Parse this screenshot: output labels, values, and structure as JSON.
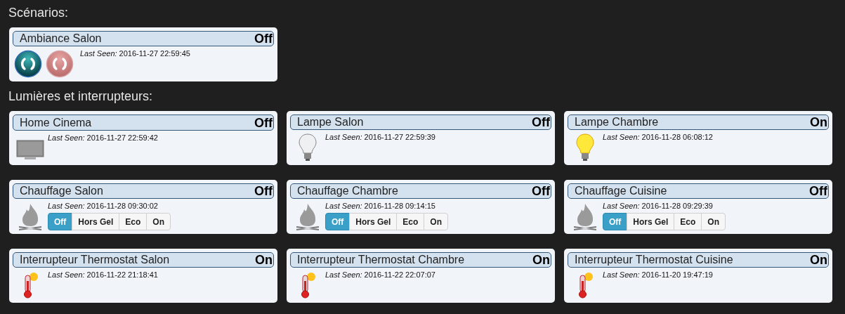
{
  "sections": [
    {
      "title": "Scénarios:",
      "devices": [
        {
          "name": "Ambiance Salon",
          "status": "Off",
          "kind": "scene",
          "last_seen_label": "Last Seen:",
          "last_seen": "2016-11-27 22:59:45"
        }
      ]
    },
    {
      "title": "Lumières et interrupteurs:",
      "devices": [
        {
          "name": "Home Cinema",
          "status": "Off",
          "kind": "tv",
          "last_seen_label": "Last Seen:",
          "last_seen": "2016-11-27 22:59:42"
        },
        {
          "name": "Lampe Salon",
          "status": "Off",
          "kind": "bulb",
          "lit": false,
          "last_seen_label": "Last Seen:",
          "last_seen": "2016-11-27 22:59:39"
        },
        {
          "name": "Lampe Chambre",
          "status": "On",
          "kind": "bulb",
          "lit": true,
          "last_seen_label": "Last Seen:",
          "last_seen": "2016-11-28 06:08:12"
        },
        {
          "name": "Chauffage Salon",
          "status": "Off",
          "kind": "fire",
          "last_seen_label": "Last Seen:",
          "last_seen": "2016-11-28 09:30:02",
          "modes": [
            {
              "label": "Off",
              "selected": true
            },
            {
              "label": "Hors Gel",
              "selected": false
            },
            {
              "label": "Eco",
              "selected": false
            },
            {
              "label": "On",
              "selected": false
            }
          ]
        },
        {
          "name": "Chauffage Chambre",
          "status": "Off",
          "kind": "fire",
          "last_seen_label": "Last Seen:",
          "last_seen": "2016-11-28 09:14:15",
          "modes": [
            {
              "label": "Off",
              "selected": true
            },
            {
              "label": "Hors Gel",
              "selected": false
            },
            {
              "label": "Eco",
              "selected": false
            },
            {
              "label": "On",
              "selected": false
            }
          ]
        },
        {
          "name": "Chauffage Cuisine",
          "status": "Off",
          "kind": "fire",
          "last_seen_label": "Last Seen:",
          "last_seen": "2016-11-28 09:29:39",
          "modes": [
            {
              "label": "Off",
              "selected": true
            },
            {
              "label": "Hors Gel",
              "selected": false
            },
            {
              "label": "Eco",
              "selected": false
            },
            {
              "label": "On",
              "selected": false
            }
          ]
        },
        {
          "name": "Interrupteur Thermostat Salon",
          "status": "On",
          "kind": "thermo",
          "last_seen_label": "Last Seen:",
          "last_seen": "2016-11-22 21:18:41"
        },
        {
          "name": "Interrupteur Thermostat Chambre",
          "status": "On",
          "kind": "thermo",
          "last_seen_label": "Last Seen:",
          "last_seen": "2016-11-22 22:07:07"
        },
        {
          "name": "Interrupteur Thermostat Cuisine",
          "status": "On",
          "kind": "thermo",
          "last_seen_label": "Last Seen:",
          "last_seen": "2016-11-20 19:47:19"
        }
      ]
    }
  ]
}
